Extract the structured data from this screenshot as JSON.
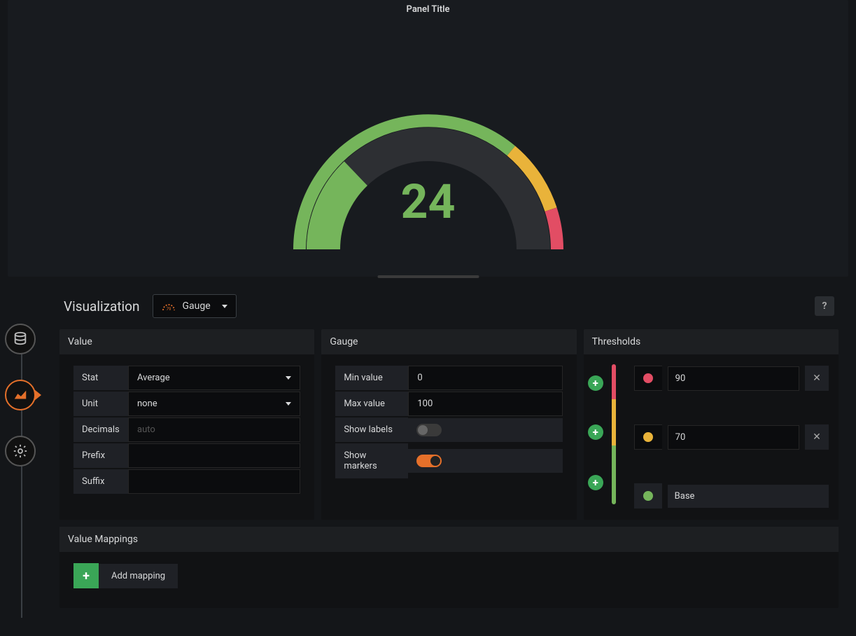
{
  "panel": {
    "title": "Panel Title",
    "value": "24"
  },
  "chart_data": {
    "type": "area",
    "title": "Panel Title",
    "value": 24,
    "min": 0,
    "max": 100,
    "thresholds": [
      {
        "label": "Base",
        "color": "#75b55b",
        "from": 0
      },
      {
        "label": "70",
        "color": "#e9b33a",
        "from": 70
      },
      {
        "label": "90",
        "color": "#e24d64",
        "from": 90
      }
    ]
  },
  "visualization": {
    "heading": "Visualization",
    "type": "Gauge"
  },
  "value_section": {
    "title": "Value",
    "stat_label": "Stat",
    "stat_value": "Average",
    "unit_label": "Unit",
    "unit_value": "none",
    "decimals_label": "Decimals",
    "decimals_placeholder": "auto",
    "decimals_value": "",
    "prefix_label": "Prefix",
    "prefix_value": "",
    "suffix_label": "Suffix",
    "suffix_value": ""
  },
  "gauge_section": {
    "title": "Gauge",
    "min_label": "Min value",
    "min_value": "0",
    "max_label": "Max value",
    "max_value": "100",
    "show_labels_label": "Show labels",
    "show_labels": false,
    "show_markers_label": "Show markers",
    "show_markers": true
  },
  "thresholds_section": {
    "title": "Thresholds",
    "rows": [
      {
        "color": "#e24d64",
        "value": "90"
      },
      {
        "color": "#e9b33a",
        "value": "70"
      }
    ],
    "base_label": "Base",
    "base_color": "#75b55b"
  },
  "value_mappings": {
    "title": "Value Mappings",
    "add_label": "Add mapping"
  },
  "icons": {
    "database": "database-icon",
    "chart": "area-chart-icon",
    "gear": "gear-icon",
    "help": "?"
  }
}
